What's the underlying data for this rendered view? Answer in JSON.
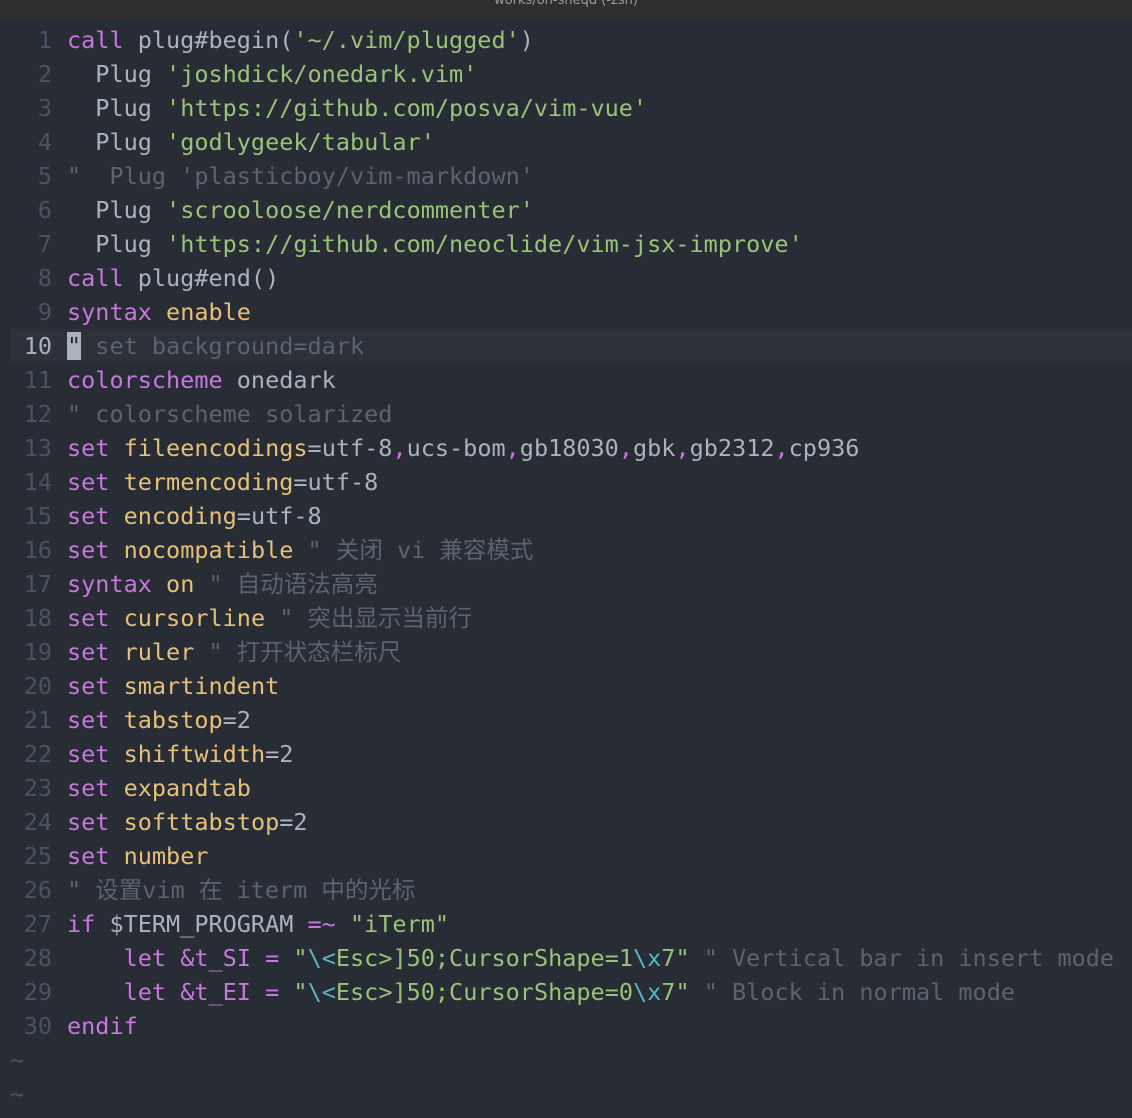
{
  "window": {
    "title": "works/on-sheqd (-zsh)"
  },
  "editor": {
    "current_line": 10,
    "lines": [
      {
        "n": "1",
        "tokens": [
          [
            "kw",
            "call"
          ],
          [
            "code",
            " plug#begin("
          ],
          [
            "str",
            "'~/.vim/plugged'"
          ],
          [
            "code",
            ")"
          ]
        ]
      },
      {
        "n": "2",
        "tokens": [
          [
            "code",
            "  Plug "
          ],
          [
            "str",
            "'joshdick/onedark.vim'"
          ]
        ]
      },
      {
        "n": "3",
        "tokens": [
          [
            "code",
            "  Plug "
          ],
          [
            "str",
            "'https://github.com/posva/vim-vue'"
          ]
        ]
      },
      {
        "n": "4",
        "tokens": [
          [
            "code",
            "  Plug "
          ],
          [
            "str",
            "'godlygeek/tabular'"
          ]
        ]
      },
      {
        "n": "5",
        "tokens": [
          [
            "cm",
            "\"  Plug 'plasticboy/vim-markdown'"
          ]
        ]
      },
      {
        "n": "6",
        "tokens": [
          [
            "code",
            "  Plug "
          ],
          [
            "str",
            "'scrooloose/nerdcommenter'"
          ]
        ]
      },
      {
        "n": "7",
        "tokens": [
          [
            "code",
            "  Plug "
          ],
          [
            "str",
            "'https://github.com/neoclide/vim-jsx-improve'"
          ]
        ]
      },
      {
        "n": "8",
        "tokens": [
          [
            "kw",
            "call"
          ],
          [
            "code",
            " plug#end()"
          ]
        ]
      },
      {
        "n": "9",
        "tokens": [
          [
            "kw",
            "syntax"
          ],
          [
            "code",
            " "
          ],
          [
            "fn",
            "enable"
          ]
        ]
      },
      {
        "n": "10",
        "tokens": [
          [
            "cursor",
            "\""
          ],
          [
            "cm",
            " set background=dark"
          ]
        ]
      },
      {
        "n": "11",
        "tokens": [
          [
            "kw",
            "colorscheme"
          ],
          [
            "code",
            " onedark"
          ]
        ]
      },
      {
        "n": "12",
        "tokens": [
          [
            "cm",
            "\" colorscheme solarized"
          ]
        ]
      },
      {
        "n": "13",
        "tokens": [
          [
            "kw",
            "set"
          ],
          [
            "code",
            " "
          ],
          [
            "fn",
            "fileencodings"
          ],
          [
            "code",
            "=utf-8"
          ],
          [
            "op",
            ","
          ],
          [
            "code",
            "ucs-bom"
          ],
          [
            "op",
            ","
          ],
          [
            "code",
            "gb18030"
          ],
          [
            "op",
            ","
          ],
          [
            "code",
            "gbk"
          ],
          [
            "op",
            ","
          ],
          [
            "code",
            "gb2312"
          ],
          [
            "op",
            ","
          ],
          [
            "code",
            "cp936"
          ]
        ]
      },
      {
        "n": "14",
        "tokens": [
          [
            "kw",
            "set"
          ],
          [
            "code",
            " "
          ],
          [
            "fn",
            "termencoding"
          ],
          [
            "code",
            "=utf-8"
          ]
        ]
      },
      {
        "n": "15",
        "tokens": [
          [
            "kw",
            "set"
          ],
          [
            "code",
            " "
          ],
          [
            "fn",
            "encoding"
          ],
          [
            "code",
            "=utf-8"
          ]
        ]
      },
      {
        "n": "16",
        "tokens": [
          [
            "kw",
            "set"
          ],
          [
            "code",
            " "
          ],
          [
            "fn",
            "nocompatible"
          ],
          [
            "cm",
            " \" 关闭 vi 兼容模式"
          ]
        ]
      },
      {
        "n": "17",
        "tokens": [
          [
            "kw",
            "syntax"
          ],
          [
            "code",
            " "
          ],
          [
            "fn",
            "on"
          ],
          [
            "cm",
            " \" 自动语法高亮"
          ]
        ]
      },
      {
        "n": "18",
        "tokens": [
          [
            "kw",
            "set"
          ],
          [
            "code",
            " "
          ],
          [
            "fn",
            "cursorline"
          ],
          [
            "cm",
            " \" 突出显示当前行"
          ]
        ]
      },
      {
        "n": "19",
        "tokens": [
          [
            "kw",
            "set"
          ],
          [
            "code",
            " "
          ],
          [
            "fn",
            "ruler"
          ],
          [
            "cm",
            " \" 打开状态栏标尺"
          ]
        ]
      },
      {
        "n": "20",
        "tokens": [
          [
            "kw",
            "set"
          ],
          [
            "code",
            " "
          ],
          [
            "fn",
            "smartindent"
          ]
        ]
      },
      {
        "n": "21",
        "tokens": [
          [
            "kw",
            "set"
          ],
          [
            "code",
            " "
          ],
          [
            "fn",
            "tabstop"
          ],
          [
            "code",
            "=2"
          ]
        ]
      },
      {
        "n": "22",
        "tokens": [
          [
            "kw",
            "set"
          ],
          [
            "code",
            " "
          ],
          [
            "fn",
            "shiftwidth"
          ],
          [
            "code",
            "=2"
          ]
        ]
      },
      {
        "n": "23",
        "tokens": [
          [
            "kw",
            "set"
          ],
          [
            "code",
            " "
          ],
          [
            "fn",
            "expandtab"
          ]
        ]
      },
      {
        "n": "24",
        "tokens": [
          [
            "kw",
            "set"
          ],
          [
            "code",
            " "
          ],
          [
            "fn",
            "softtabstop"
          ],
          [
            "code",
            "=2"
          ]
        ]
      },
      {
        "n": "25",
        "tokens": [
          [
            "kw",
            "set"
          ],
          [
            "code",
            " "
          ],
          [
            "fn",
            "number"
          ]
        ]
      },
      {
        "n": "26",
        "tokens": [
          [
            "cm",
            "\" 设置vim 在 iterm 中的光标"
          ]
        ]
      },
      {
        "n": "27",
        "tokens": [
          [
            "kw",
            "if"
          ],
          [
            "code",
            " $TERM_PROGRAM "
          ],
          [
            "op",
            "=~"
          ],
          [
            "code",
            " "
          ],
          [
            "str",
            "\"iTerm\""
          ]
        ]
      },
      {
        "n": "28",
        "tokens": [
          [
            "code",
            "    "
          ],
          [
            "kw",
            "let"
          ],
          [
            "code",
            " "
          ],
          [
            "kw",
            "&t_SI"
          ],
          [
            "code",
            " "
          ],
          [
            "op",
            "="
          ],
          [
            "code",
            " "
          ],
          [
            "str",
            "\""
          ],
          [
            "esc",
            "\\<"
          ],
          [
            "str",
            "Esc>]50;CursorShape=1"
          ],
          [
            "esc",
            "\\x"
          ],
          [
            "str",
            "7\""
          ],
          [
            "cm",
            " \" Vertical bar in insert mode"
          ]
        ]
      },
      {
        "n": "29",
        "tokens": [
          [
            "code",
            "    "
          ],
          [
            "kw",
            "let"
          ],
          [
            "code",
            " "
          ],
          [
            "kw",
            "&t_EI"
          ],
          [
            "code",
            " "
          ],
          [
            "op",
            "="
          ],
          [
            "code",
            " "
          ],
          [
            "str",
            "\""
          ],
          [
            "esc",
            "\\<"
          ],
          [
            "str",
            "Esc>]50;CursorShape=0"
          ],
          [
            "esc",
            "\\x"
          ],
          [
            "str",
            "7\""
          ],
          [
            "cm",
            " \" Block in normal mode"
          ]
        ]
      },
      {
        "n": "30",
        "tokens": [
          [
            "kw",
            "endif"
          ]
        ]
      }
    ],
    "tildes": [
      "~",
      "~"
    ]
  },
  "colors": {
    "background": "#282c34",
    "keyword": "#c678dd",
    "identifier": "#e5c07b",
    "string": "#98c379",
    "comment": "#5c6370",
    "escape": "#56b6c2",
    "text": "#abb2bf",
    "line_number": "#4b5263"
  }
}
